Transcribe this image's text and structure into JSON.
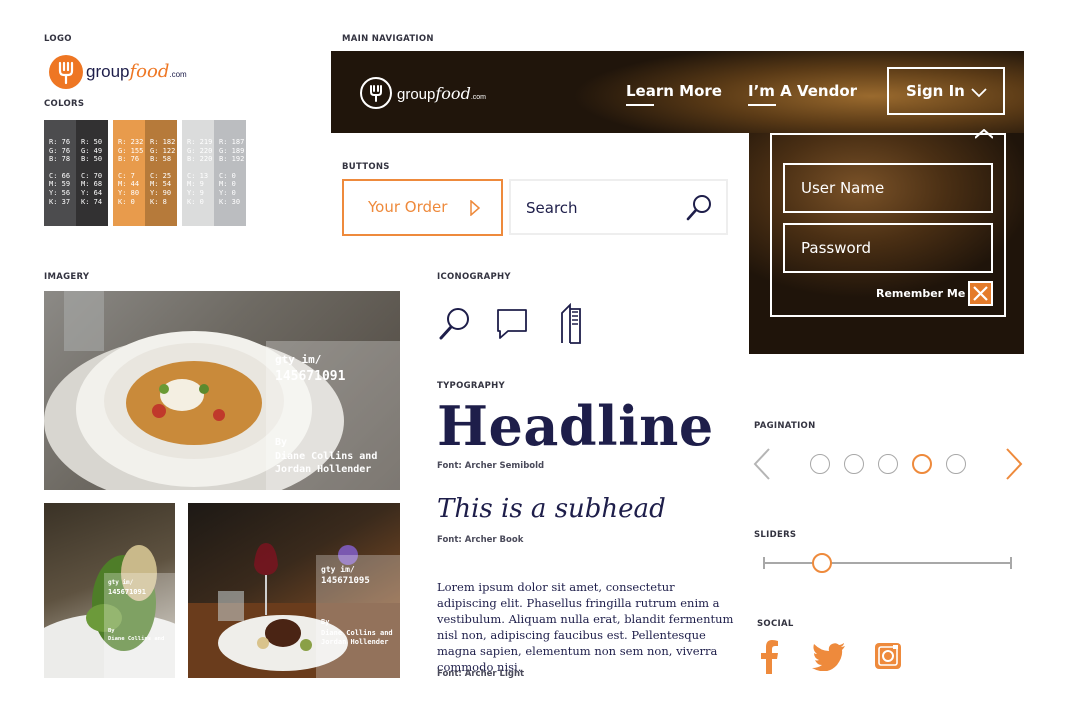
{
  "section_labels": {
    "logo": "LOGO",
    "colors": "COLORS",
    "main_navigation": "MAIN NAVIGATION",
    "buttons": "BUTTONS",
    "imagery": "IMAGERY",
    "iconography": "ICONOGRAPHY",
    "typography": "TYPOGRAPHY",
    "pagination": "PAGINATION",
    "sliders": "SLIDERS",
    "social": "SOCIAL"
  },
  "brand": {
    "name_part1": "group",
    "name_part2": "food",
    "suffix": ".com",
    "primary_color": "#ee7623",
    "navy_color": "#1e1e4a"
  },
  "swatches": [
    {
      "bg": "#4c4c4e",
      "rgb": [
        "R: 76",
        "G: 76",
        "B: 78"
      ],
      "cmyk": [
        "C: 66",
        "M: 59",
        "Y: 56",
        "K: 37"
      ]
    },
    {
      "bg": "#323132",
      "rgb": [
        "R: 50",
        "G: 49",
        "B: 50"
      ],
      "cmyk": [
        "C: 70",
        "M: 68",
        "Y: 64",
        "K: 74"
      ]
    },
    {
      "bg": "#e89b4c",
      "rgb": [
        "R: 232",
        "G: 155",
        "B: 76"
      ],
      "cmyk": [
        "C: 7",
        "M: 44",
        "Y: 80",
        "K: 0"
      ]
    },
    {
      "bg": "#b67a3a",
      "rgb": [
        "R: 182",
        "G: 122",
        "B: 58"
      ],
      "cmyk": [
        "C: 25",
        "M: 54",
        "Y: 90",
        "K: 8"
      ]
    },
    {
      "bg": "#dbdcdc",
      "rgb": [
        "R: 219",
        "G: 220",
        "B: 220"
      ],
      "cmyk": [
        "C: 13",
        "M: 9",
        "Y: 9",
        "K: 0"
      ]
    },
    {
      "bg": "#bbbdc0",
      "rgb": [
        "R: 187",
        "G: 189",
        "B: 192"
      ],
      "cmyk": [
        "C: 0",
        "M: 0",
        "Y: 0",
        "K: 30"
      ]
    }
  ],
  "nav": {
    "learn_more": "Learn More",
    "vendor": "I’m A Vendor",
    "sign_in": "Sign In",
    "username_placeholder": "User Name",
    "password_placeholder": "Password",
    "remember_me": "Remember Me"
  },
  "buttons": {
    "your_order": "Your Order",
    "search": "Search"
  },
  "imagery": {
    "main": {
      "credit_line1": "gty im/",
      "credit_line2": "145671091",
      "by": "By",
      "author_line1": "Diane Collins and",
      "author_line2": "Jordan Hollender"
    },
    "small_left": {
      "credit_line1": "gty im/",
      "credit_line2": "145671091",
      "by": "By",
      "author_line1": "Diane Collins and",
      "author_line2": "Jordan Hollender"
    },
    "small_right": {
      "credit_line1": "gty im/",
      "credit_line2": "145671095",
      "by": "By",
      "author_line1": "Diane Collins and",
      "author_line2": "Jordan Hollender"
    }
  },
  "typography": {
    "headline": "Headline",
    "headline_font": "Font: Archer Semibold",
    "subhead": "This is a subhead",
    "subhead_font": "Font: Archer Book",
    "body": "Lorem ipsum dolor sit amet, consectetur adipiscing elit. Phasellus fringilla rutrum enim a vestibulum. Aliquam nulla erat, blandit fermentum nisl non, adipiscing faucibus est. Pellentesque magna sapien, elementum non sem non, viverra commodo nisi.",
    "body_font": "Font: Archer Light"
  },
  "pagination": {
    "pages": 5,
    "active_page": 4
  },
  "slider": {
    "value_fraction": 0.24
  },
  "social": [
    "facebook-icon",
    "twitter-icon",
    "instagram-icon"
  ]
}
